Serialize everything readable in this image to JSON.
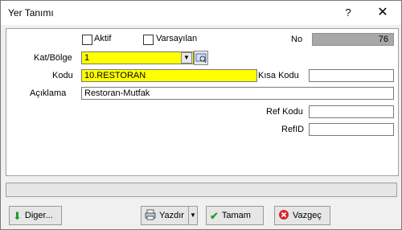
{
  "window": {
    "title": "Yer Tanımı",
    "help_label": "?",
    "close_label": "✕"
  },
  "form": {
    "aktif_label": "Aktif",
    "varsayilan_label": "Varsayılan",
    "no_label": "No",
    "no_value": "76",
    "kat_bolge_label": "Kat/Bölge",
    "kat_bolge_value": "1",
    "kodu_label": "Kodu",
    "kodu_value": "10.RESTORAN",
    "kisa_kodu_label": "Kısa Kodu",
    "kisa_kodu_value": "",
    "aciklama_label": "Açıklama",
    "aciklama_value": "Restoran-Mutfak",
    "ref_kodu_label": "Ref Kodu",
    "ref_kodu_value": "",
    "refid_label": "RefID",
    "refid_value": ""
  },
  "buttons": {
    "diger": "Diger...",
    "yazdir": "Yazdır",
    "tamam": "Tamam",
    "vazgec": "Vazgeç"
  },
  "colors": {
    "required_field": "#ffff00",
    "readonly_field": "#a8a8a8"
  },
  "icons": {
    "diger": "green-down-arrow-icon",
    "yazdir": "print-icon",
    "tamam": "green-check-icon",
    "vazgec": "red-cancel-icon"
  }
}
